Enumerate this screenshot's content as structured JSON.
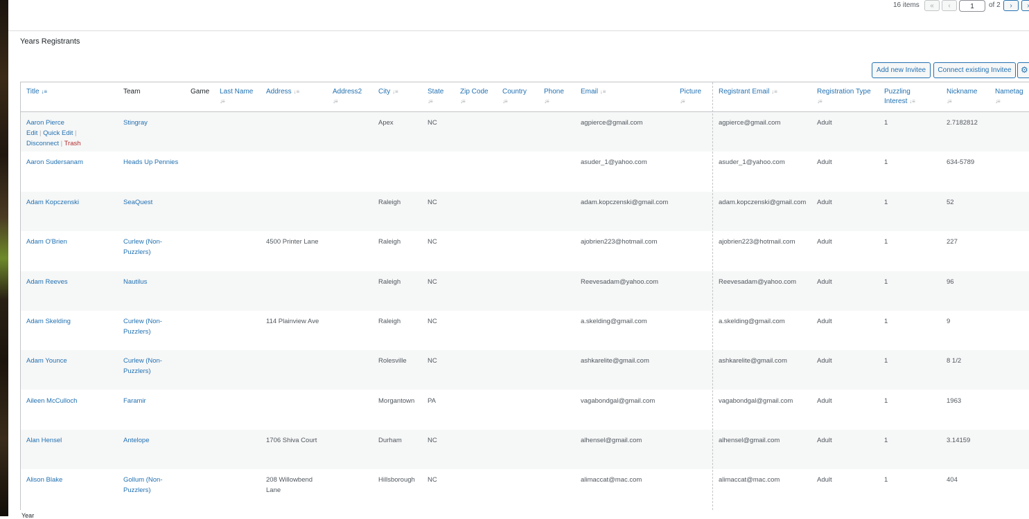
{
  "pagination": {
    "items_count": "16 items",
    "first": "«",
    "prev": "‹",
    "current_page": "1",
    "of_pages": "of 2",
    "next": "›",
    "last": "»"
  },
  "box": {
    "title": "Years Registrants",
    "add_button": "Add new Invitee",
    "connect_button": "Connect existing Invitee",
    "gear_icon": "gear-icon"
  },
  "columns": {
    "title": "Title",
    "team": "Team",
    "game": "Game",
    "last_name": "Last Name",
    "address": "Address",
    "address2": "Address2",
    "city": "City",
    "state": "State",
    "zip": "Zip Code",
    "country": "Country",
    "phone": "Phone",
    "email": "Email",
    "picture": "Picture",
    "registrant_email": "Registrant Email",
    "registration_type": "Registration Type",
    "puzzling_interest_1": "Puzzling",
    "puzzling_interest_2": "Interest",
    "nickname": "Nickname",
    "nametag": "Nametag"
  },
  "row_actions": {
    "edit": "Edit",
    "quick_edit": "Quick Edit",
    "disconnect": "Disconnect",
    "trash": "Trash"
  },
  "rows": [
    {
      "title": "Aaron Pierce",
      "team": "Stingray",
      "team2": "",
      "address": "",
      "address_2": "",
      "city": "Apex",
      "state": "NC",
      "email": "agpierce@gmail.com",
      "registrant_email": "agpierce@gmail.com",
      "type": "Adult",
      "interest": "1",
      "nickname": "2.7182812"
    },
    {
      "title": "Aaron Sudersanam",
      "team": "Heads Up Pennies",
      "team2": "",
      "address": "",
      "address_2": "",
      "city": "",
      "state": "",
      "email": "asuder_1@yahoo.com",
      "registrant_email": "asuder_1@yahoo.com",
      "type": "Adult",
      "interest": "1",
      "nickname": "634-5789"
    },
    {
      "title": "Adam Kopczenski",
      "team": "SeaQuest",
      "team2": "",
      "address": "",
      "address_2": "",
      "city": "Raleigh",
      "state": "NC",
      "email": "adam.kopczenski@gmail.com",
      "registrant_email": "adam.kopczenski@gmail.com",
      "type": "Adult",
      "interest": "1",
      "nickname": "52"
    },
    {
      "title": "Adam O'Brien",
      "team": "Curlew (Non-",
      "team2": "Puzzlers)",
      "address": "4500 Printer Lane",
      "address_2": "",
      "city": "Raleigh",
      "state": "NC",
      "email": "ajobrien223@hotmail.com",
      "registrant_email": "ajobrien223@hotmail.com",
      "type": "Adult",
      "interest": "1",
      "nickname": "227"
    },
    {
      "title": "Adam Reeves",
      "team": "Nautilus",
      "team2": "",
      "address": "",
      "address_2": "",
      "city": "Raleigh",
      "state": "NC",
      "email": "Reevesadam@yahoo.com",
      "registrant_email": "Reevesadam@yahoo.com",
      "type": "Adult",
      "interest": "1",
      "nickname": "96"
    },
    {
      "title": "Adam Skelding",
      "team": "Curlew (Non-",
      "team2": "Puzzlers)",
      "address": "114 Plainview Ave",
      "address_2": "",
      "city": "Raleigh",
      "state": "NC",
      "email": "a.skelding@gmail.com",
      "registrant_email": "a.skelding@gmail.com",
      "type": "Adult",
      "interest": "1",
      "nickname": "9"
    },
    {
      "title": "Adam Younce",
      "team": "Curlew (Non-",
      "team2": "Puzzlers)",
      "address": "",
      "address_2": "",
      "city": "Rolesville",
      "state": "NC",
      "email": "ashkarelite@gmail.com",
      "registrant_email": "ashkarelite@gmail.com",
      "type": "Adult",
      "interest": "1",
      "nickname": "8 1/2"
    },
    {
      "title": "Aileen McCulloch",
      "team": "Faramir",
      "team2": "",
      "address": "",
      "address_2": "",
      "city": "Morgantown",
      "state": "PA",
      "email": "vagabondgal@gmail.com",
      "registrant_email": "vagabondgal@gmail.com",
      "type": "Adult",
      "interest": "1",
      "nickname": "1963"
    },
    {
      "title": "Alan Hensel",
      "team": "Antelope",
      "team2": "",
      "address": "1706 Shiva Court",
      "address_2": "",
      "city": "Durham",
      "state": "NC",
      "email": "alhensel@gmail.com",
      "registrant_email": "alhensel@gmail.com",
      "type": "Adult",
      "interest": "1",
      "nickname": "3.14159"
    },
    {
      "title": "Alison Blake",
      "team": "Gollum (Non-",
      "team2": "Puzzlers)",
      "address": "208 Willowbend",
      "address_2": "Lane",
      "city": "Hillsborough",
      "state": "NC",
      "email": "alimaccat@mac.com",
      "registrant_email": "alimaccat@mac.com",
      "type": "Adult",
      "interest": "1",
      "nickname": "404"
    }
  ],
  "bottom_label": "Year"
}
